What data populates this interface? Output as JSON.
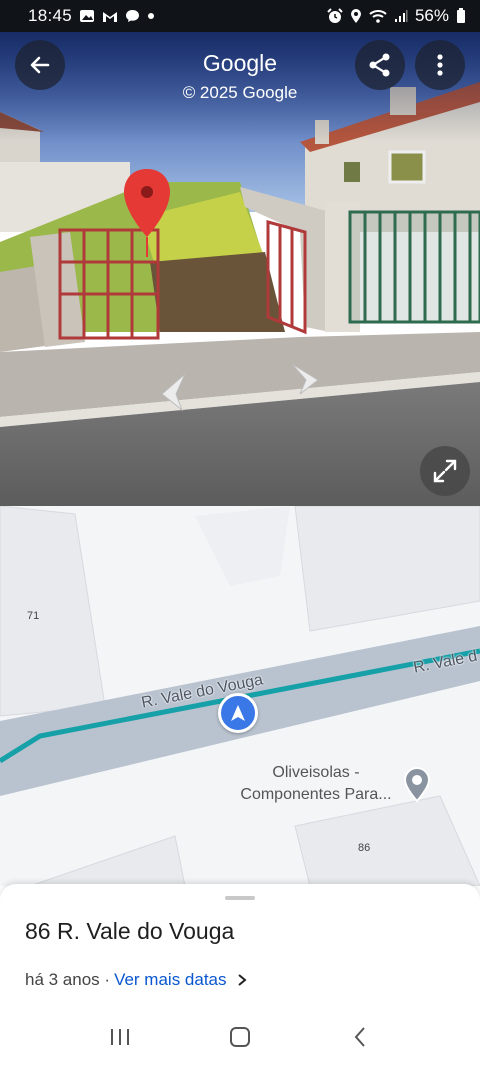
{
  "status": {
    "time": "18:45",
    "battery": "56%",
    "icons_left": [
      "gallery-icon",
      "gmail-icon",
      "chat-icon",
      "dot-icon"
    ],
    "icons_right": [
      "alarm-icon",
      "location-icon",
      "wifi-icon",
      "signal-icon",
      "battery-icon"
    ]
  },
  "street_view": {
    "title": "Google",
    "copyright": "© 2025 Google"
  },
  "map": {
    "street_name": "R. Vale do Vouga",
    "street_name_2": "R. Vale d",
    "building_71": "71",
    "building_86": "86",
    "poi_line1": "Oliveisolas -",
    "poi_line2": "Componentes Para...",
    "route_color": "#16a0a8"
  },
  "sheet": {
    "address": "86 R. Vale do Vouga",
    "date_text": "há 3 anos ·",
    "more_dates_link": "Ver mais datas"
  },
  "colors": {
    "accent": "#0b57d0",
    "pin": "#e53935",
    "nav_arrow": "#3b78e7"
  }
}
